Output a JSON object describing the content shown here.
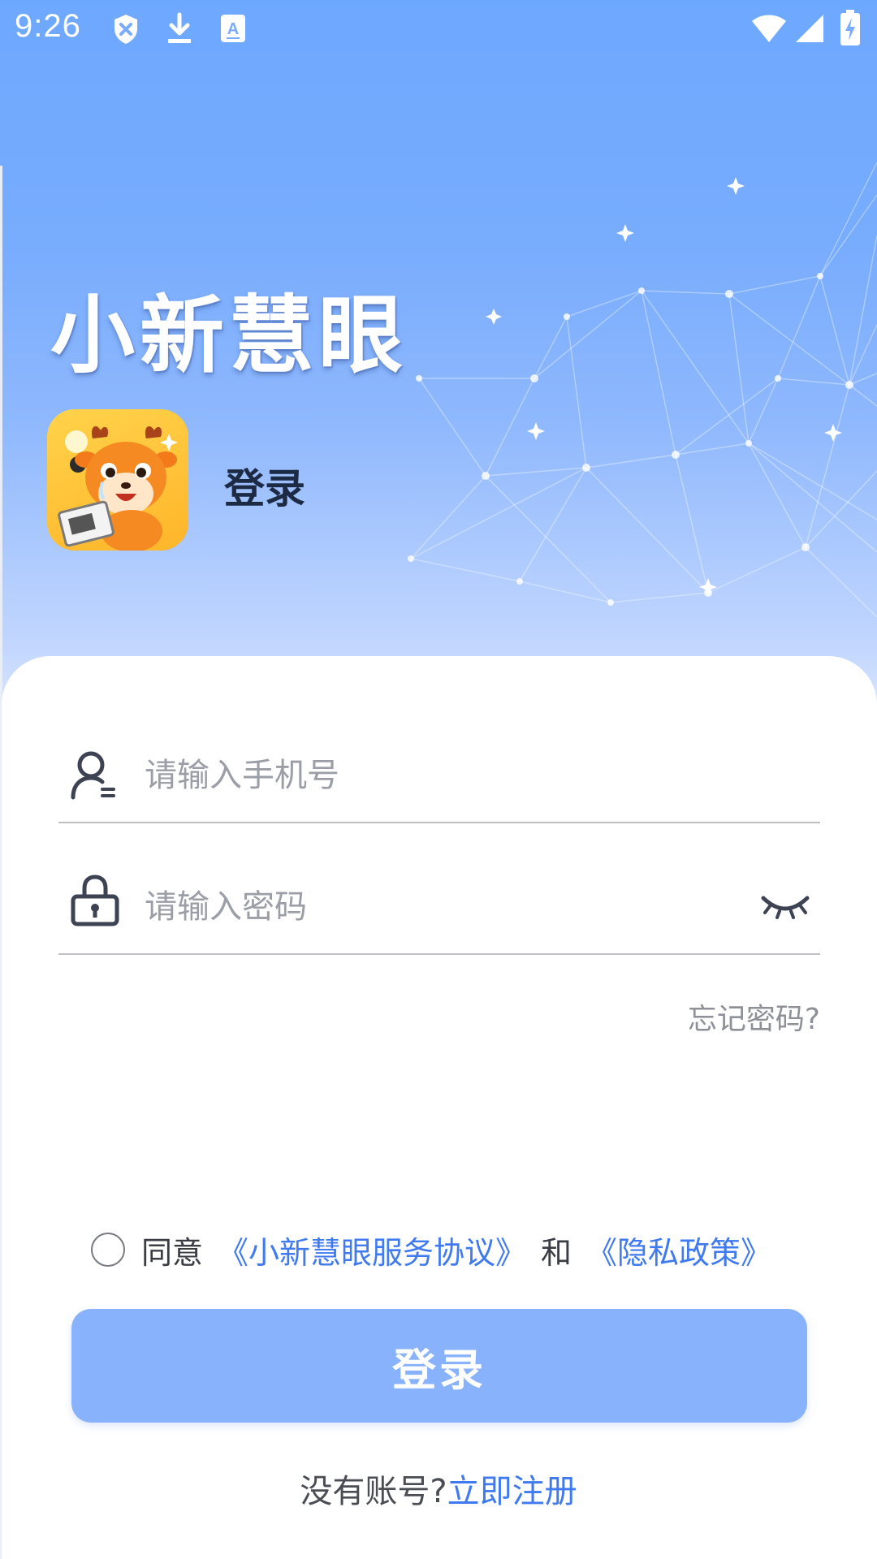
{
  "status_bar": {
    "time": "9:26",
    "icons": [
      "shield-icon",
      "download-icon",
      "keyboard-a-icon",
      "wifi-icon",
      "signal-icon",
      "battery-charging-icon"
    ]
  },
  "header": {
    "app_title": "小新慧眼",
    "page_title": "登录"
  },
  "form": {
    "phone_placeholder": "请输入手机号",
    "password_placeholder": "请输入密码",
    "forgot_password": "忘记密码?"
  },
  "agreement": {
    "prefix": "同意",
    "service_link": "《小新慧眼服务协议》",
    "and": "和",
    "privacy_link": "《隐私政策》",
    "checked": false
  },
  "login_button": "登录",
  "register": {
    "prompt": "没有账号?",
    "link": "立即注册"
  },
  "colors": {
    "accent": "#3f7af0",
    "button": "#88b2fb",
    "header_gradient_top": "#6da8ff",
    "header_gradient_bottom": "#dbe7ff"
  }
}
